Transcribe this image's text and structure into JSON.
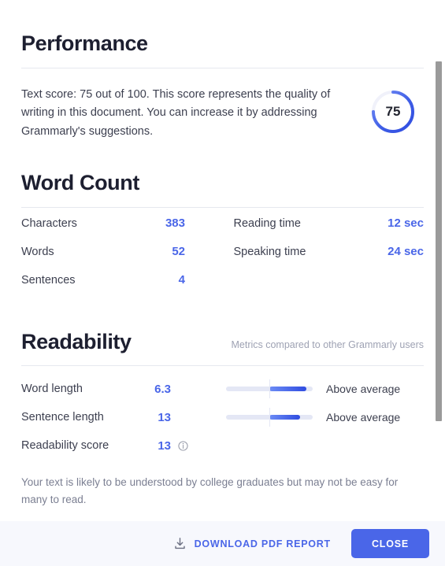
{
  "performance": {
    "title": "Performance",
    "description": "Text score: 75 out of 100. This score represents the quality of writing in this document. You can increase it by addressing Grammarly's suggestions.",
    "score": "75",
    "score_percent": 75,
    "ring_color_start": "#7a93f7",
    "ring_color_end": "#2f4ce0",
    "ring_track_color": "#f0f1fa"
  },
  "word_count": {
    "title": "Word Count",
    "left_metrics": [
      {
        "label": "Characters",
        "value": "383"
      },
      {
        "label": "Words",
        "value": "52"
      },
      {
        "label": "Sentences",
        "value": "4"
      }
    ],
    "right_metrics": [
      {
        "label": "Reading time",
        "value": "12 sec"
      },
      {
        "label": "Speaking time",
        "value": "24 sec"
      }
    ]
  },
  "readability": {
    "title": "Readability",
    "note": "Metrics compared to other Grammarly users",
    "metrics": [
      {
        "label": "Word length",
        "value": "6.3",
        "caption": "Above average",
        "fill_start_pct": 50,
        "fill_end_pct": 93,
        "has_info": false
      },
      {
        "label": "Sentence length",
        "value": "13",
        "caption": "Above average",
        "fill_start_pct": 50,
        "fill_end_pct": 85,
        "has_info": false
      },
      {
        "label": "Readability score",
        "value": "13",
        "caption": "",
        "fill_start_pct": 0,
        "fill_end_pct": 0,
        "has_info": true
      }
    ],
    "summary": "Your text is likely to be understood by college graduates but may not be easy for many to read."
  },
  "footer": {
    "download_label": "DOWNLOAD PDF REPORT",
    "close_label": "CLOSE",
    "accent_color": "#4a66e8"
  }
}
